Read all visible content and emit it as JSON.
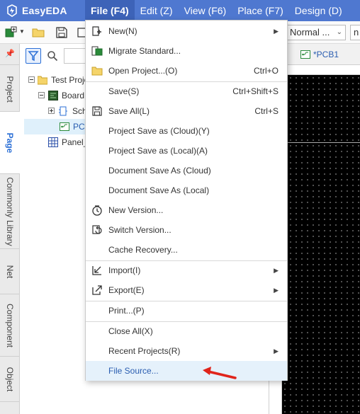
{
  "app": {
    "logo_text": "EasyEDA"
  },
  "menubar": {
    "items": [
      {
        "label": "File (F4)",
        "active": true
      },
      {
        "label": "Edit (Z)"
      },
      {
        "label": "View (F6)"
      },
      {
        "label": "Place (F7)"
      },
      {
        "label": "Design (D)"
      }
    ]
  },
  "toolbar": {
    "mode_select": "Normal ...",
    "partial_select": "n"
  },
  "left_tabs": [
    "Project",
    "Page",
    "Commonly Library",
    "Net",
    "Component",
    "Object"
  ],
  "left_tabs_active": "Page",
  "tree": {
    "search_placeholder": "",
    "nodes": [
      {
        "label": "Test Proje",
        "icon": "folder-icon"
      },
      {
        "label": "Board",
        "icon": "board-icon"
      },
      {
        "label": "Sch",
        "icon": "schematic-icon"
      },
      {
        "label": "PC",
        "icon": "pcb-icon",
        "selected": true
      },
      {
        "label": "Panel_",
        "icon": "panel-icon"
      }
    ]
  },
  "document_tab": {
    "label": "*PCB1"
  },
  "file_menu": {
    "items": [
      {
        "label": "New(N)",
        "icon": "new-icon",
        "submenu": true
      },
      {
        "label": "Migrate Standard...",
        "icon": "migrate-icon"
      },
      {
        "label": "Open Project...(O)",
        "icon": "folder-icon",
        "shortcut": "Ctrl+O"
      },
      {
        "label": "Save(S)",
        "shortcut": "Ctrl+Shift+S"
      },
      {
        "label": "Save All(L)",
        "icon": "save-icon",
        "shortcut": "Ctrl+S"
      },
      {
        "label": "Project Save as (Cloud)(Y)"
      },
      {
        "label": "Project Save as (Local)(A)"
      },
      {
        "label": "Document Save As (Cloud)"
      },
      {
        "label": "Document Save As (Local)"
      },
      {
        "label": "New Version...",
        "icon": "version-icon"
      },
      {
        "label": "Switch Version...",
        "icon": "switch-version-icon"
      },
      {
        "label": "Cache Recovery..."
      },
      {
        "label": "Import(I)",
        "icon": "import-icon",
        "submenu": true
      },
      {
        "label": "Export(E)",
        "icon": "export-icon",
        "submenu": true
      },
      {
        "label": "Print...(P)"
      },
      {
        "label": "Close All(X)"
      },
      {
        "label": "Recent Projects(R)",
        "submenu": true
      },
      {
        "label": "File Source...",
        "highlighted": true
      }
    ]
  },
  "colors": {
    "menubar": "#4f78d0",
    "accent": "#2b6fd6",
    "highlight": "#e5f1fb",
    "annotation_arrow": "#e0241b"
  }
}
